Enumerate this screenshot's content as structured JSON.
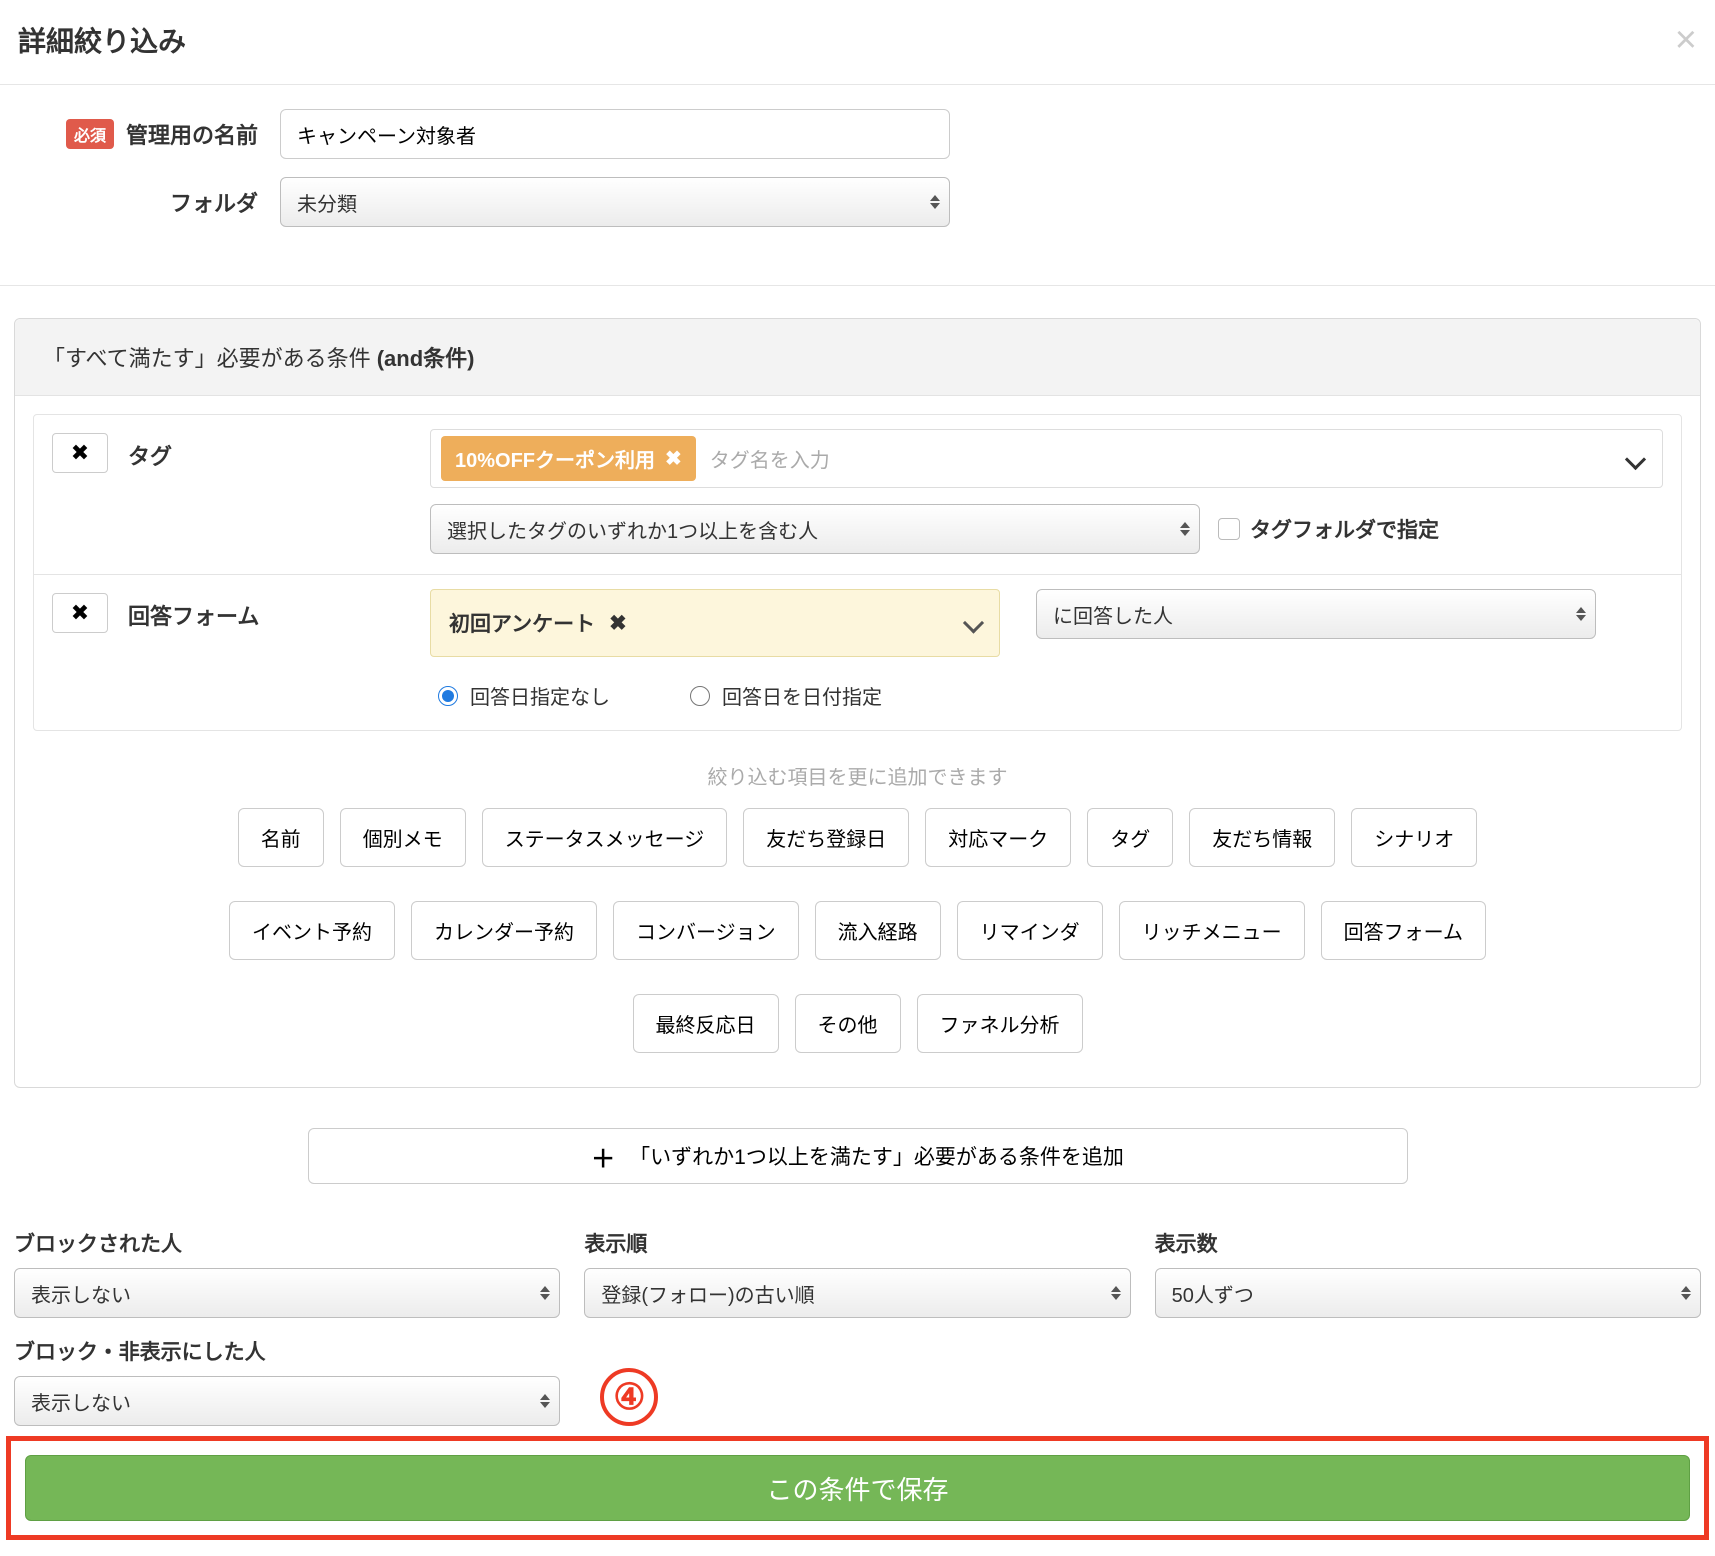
{
  "header": {
    "title": "詳細絞り込み"
  },
  "top": {
    "name_label": "管理用の名前",
    "required_badge": "必須",
    "name_value": "キャンペーン対象者",
    "folder_label": "フォルダ",
    "folder_value": "未分類"
  },
  "and_card": {
    "header_prefix": "「すべて満たす」必要がある条件 ",
    "header_suffix": "(and条件)",
    "tag": {
      "label": "タグ",
      "chip": "10%OFFクーポン利用",
      "placeholder": "タグ名を入力",
      "mode": "選択したタグのいずれか1つ以上を含む人",
      "folder_cb": "タグフォルダで指定"
    },
    "form": {
      "label": "回答フォーム",
      "survey": "初回アンケート",
      "resp_mode": "に回答した人",
      "radio_a": "回答日指定なし",
      "radio_b": "回答日を日付指定"
    },
    "more_hint": "絞り込む項目を更に追加できます",
    "pills_row1": [
      "名前",
      "個別メモ",
      "ステータスメッセージ",
      "友だち登録日",
      "対応マーク",
      "タグ",
      "友だち情報",
      "シナリオ"
    ],
    "pills_row2": [
      "イベント予約",
      "カレンダー予約",
      "コンバージョン",
      "流入経路",
      "リマインダ",
      "リッチメニュー",
      "回答フォーム"
    ],
    "pills_row3": [
      "最終反応日",
      "その他",
      "ファネル分析"
    ]
  },
  "or_button": "「いずれか1つ以上を満たす」必要がある条件を追加",
  "bottom": {
    "blocked_label": "ブロックされた人",
    "blocked_value": "表示しない",
    "sort_label": "表示順",
    "sort_value": "登録(フォロー)の古い順",
    "count_label": "表示数",
    "count_value": "50人ずつ",
    "hidden_label": "ブロック・非表示にした人",
    "hidden_value": "表示しない"
  },
  "step_badge": "④",
  "save_button": "この条件で保存"
}
